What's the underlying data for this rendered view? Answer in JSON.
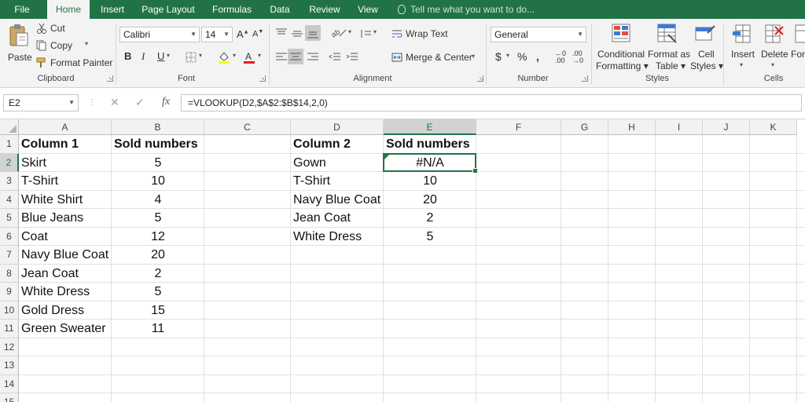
{
  "menu": {
    "tabs": [
      "File",
      "Home",
      "Insert",
      "Page Layout",
      "Formulas",
      "Data",
      "Review",
      "View"
    ],
    "active_tab": "Home",
    "tell_me": "Tell me what you want to do..."
  },
  "ribbon": {
    "clipboard": {
      "paste": "Paste",
      "cut": "Cut",
      "copy": "Copy",
      "format_painter": "Format Painter",
      "label": "Clipboard"
    },
    "font": {
      "name": "Calibri",
      "size": "14",
      "label": "Font"
    },
    "alignment": {
      "wrap_text": "Wrap Text",
      "merge_center": "Merge & Center",
      "label": "Alignment"
    },
    "number": {
      "format": "General",
      "label": "Number"
    },
    "styles": {
      "conditional": "Conditional",
      "formatting": "Formatting",
      "format_as": "Format as",
      "table": "Table",
      "cell": "Cell",
      "cell_styles": "Styles",
      "label": "Styles"
    },
    "cells": {
      "insert": "Insert",
      "delete": "Delete",
      "format": "Form",
      "label": "Cells"
    }
  },
  "formula_bar": {
    "name_box": "E2",
    "fx": "fx",
    "formula": "=VLOOKUP(D2,$A$2:$B$14,2,0)"
  },
  "sheet": {
    "columns": [
      "A",
      "B",
      "C",
      "D",
      "E",
      "F",
      "G",
      "H",
      "I",
      "J",
      "K"
    ],
    "rows": [
      "1",
      "2",
      "3",
      "4",
      "5",
      "6",
      "7",
      "8",
      "9",
      "10",
      "11",
      "12",
      "13",
      "14",
      "15"
    ],
    "selected_column": "E",
    "selected_row": "2",
    "table1": {
      "header_a": "Column 1",
      "header_b": "Sold numbers",
      "rows": [
        {
          "item": "Skirt",
          "sold": "5"
        },
        {
          "item": "T-Shirt",
          "sold": "10"
        },
        {
          "item": "White Shirt",
          "sold": "4"
        },
        {
          "item": "Blue Jeans",
          "sold": "5"
        },
        {
          "item": "Coat",
          "sold": "12"
        },
        {
          "item": "Navy Blue Coat",
          "sold": "20"
        },
        {
          "item": "Jean Coat",
          "sold": "2"
        },
        {
          "item": "White Dress",
          "sold": "5"
        },
        {
          "item": "Gold Dress",
          "sold": "15"
        },
        {
          "item": "Green Sweater",
          "sold": "11"
        }
      ]
    },
    "table2": {
      "header_d": "Column 2",
      "header_e": "Sold numbers",
      "rows": [
        {
          "item": "Gown",
          "sold": "#N/A"
        },
        {
          "item": "T-Shirt",
          "sold": "10"
        },
        {
          "item": "Navy Blue Coat",
          "sold": "20"
        },
        {
          "item": "Jean Coat",
          "sold": "2"
        },
        {
          "item": "White Dress",
          "sold": "5"
        }
      ]
    }
  },
  "colors": {
    "excel_green": "#217346",
    "ribbon_bg": "#f3f3f3"
  }
}
